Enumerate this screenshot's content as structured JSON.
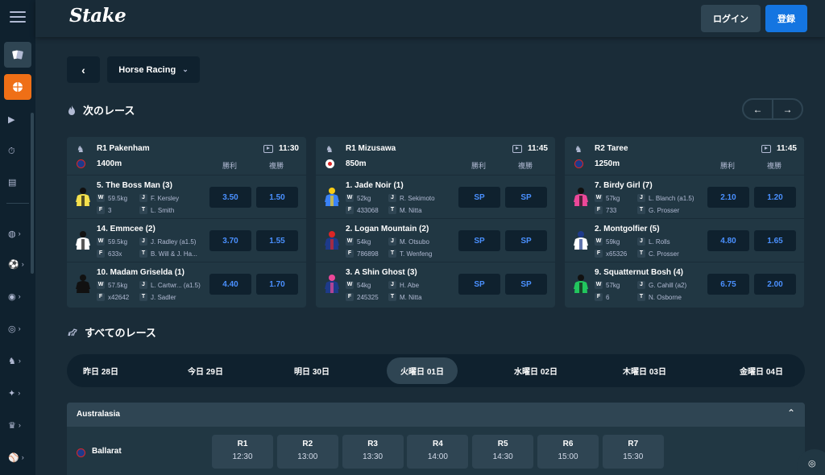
{
  "header": {
    "logo": "Stake",
    "login_label": "ログイン",
    "register_label": "登録"
  },
  "sidebar": {
    "items": [
      {
        "icon": "casino-icon"
      },
      {
        "icon": "sports-icon",
        "active": true
      },
      {
        "icon": "live-icon"
      },
      {
        "icon": "stopwatch-icon"
      },
      {
        "icon": "betslip-icon"
      },
      {
        "icon": "tennis-icon"
      },
      {
        "icon": "soccer-icon"
      },
      {
        "icon": "basketball-icon"
      },
      {
        "icon": "volleyball-icon"
      },
      {
        "icon": "horse-icon"
      },
      {
        "icon": "cricket-icon"
      },
      {
        "icon": "trophy-icon"
      },
      {
        "icon": "baseball-icon"
      }
    ]
  },
  "filter": {
    "sport": "Horse Racing"
  },
  "next_races": {
    "title": "次のレース",
    "win_label": "勝利",
    "place_label": "複勝",
    "cards": [
      {
        "race": "R1 Pakenham",
        "time": "11:30",
        "distance": "1400m",
        "flag_color": "#1e3a8a",
        "runners": [
          {
            "name": "5. The Boss Man  (3)",
            "weight": "59.5kg",
            "jockey": "F. Kersley",
            "form": "3",
            "trainer": "L. Smith",
            "win": "3.50",
            "place": "1.50",
            "silk": [
              "#f4e04d",
              "#111111"
            ]
          },
          {
            "name": "14. Emmcee  (2)",
            "weight": "59.5kg",
            "jockey": "J. Radley (a1.5)",
            "form": "633x",
            "trainer": "B. Will & J. Ha...",
            "win": "3.70",
            "place": "1.55",
            "silk": [
              "#ffffff",
              "#111111"
            ]
          },
          {
            "name": "10. Madam Griselda  (1)",
            "weight": "57.5kg",
            "jockey": "L. Cartwr...  (a1.5)",
            "form": "x42642",
            "trainer": "J. Sadler",
            "win": "4.40",
            "place": "1.70",
            "silk": [
              "#111111",
              "#111111"
            ]
          }
        ]
      },
      {
        "race": "R1 Mizusawa",
        "time": "11:45",
        "distance": "850m",
        "flag_color": "#ffffff",
        "runners": [
          {
            "name": "1. Jade Noir  (1)",
            "weight": "52kg",
            "jockey": "R. Sekimoto",
            "form": "433068",
            "trainer": "M. Nitta",
            "win": "SP",
            "place": "SP",
            "silk": [
              "#3b82f6",
              "#facc15"
            ]
          },
          {
            "name": "2. Logan Mountain  (2)",
            "weight": "54kg",
            "jockey": "M. Otsubo",
            "form": "786898",
            "trainer": "T. Wenfeng",
            "win": "SP",
            "place": "SP",
            "silk": [
              "#1e3a8a",
              "#dc2626"
            ]
          },
          {
            "name": "3. A Shin Ghost  (3)",
            "weight": "54kg",
            "jockey": "H. Abe",
            "form": "245325",
            "trainer": "M. Nitta",
            "win": "SP",
            "place": "SP",
            "silk": [
              "#1e3a8a",
              "#ec4899"
            ]
          }
        ]
      },
      {
        "race": "R2 Taree",
        "time": "11:45",
        "distance": "1250m",
        "flag_color": "#1e3a8a",
        "runners": [
          {
            "name": "7. Birdy Girl  (7)",
            "weight": "57kg",
            "jockey": "L. Blanch (a1.5)",
            "form": "733",
            "trainer": "G. Prosser",
            "win": "2.10",
            "place": "1.20",
            "silk": [
              "#ec4899",
              "#111111"
            ]
          },
          {
            "name": "2. Montgolfier  (5)",
            "weight": "59kg",
            "jockey": "L. Rolls",
            "form": "x65326",
            "trainer": "C. Prosser",
            "win": "4.80",
            "place": "1.65",
            "silk": [
              "#ffffff",
              "#1e3a8a"
            ]
          },
          {
            "name": "9. Squatternut Bosh  (4)",
            "weight": "57kg",
            "jockey": "G. Cahill (a2)",
            "form": "6",
            "trainer": "N. Osborne",
            "win": "6.75",
            "place": "2.00",
            "silk": [
              "#22c55e",
              "#111111"
            ]
          }
        ]
      }
    ]
  },
  "all_races": {
    "title": "すべてのレース",
    "dates": [
      {
        "label": "昨日 28日"
      },
      {
        "label": "今日 29日"
      },
      {
        "label": "明日 30日"
      },
      {
        "label": "火曜日 01日",
        "active": true
      },
      {
        "label": "水曜日 02日"
      },
      {
        "label": "木曜日 03日"
      },
      {
        "label": "金曜日 04日"
      }
    ],
    "region": "Australasia",
    "track": "Ballarat",
    "races": [
      {
        "num": "R1",
        "time": "12:30"
      },
      {
        "num": "R2",
        "time": "13:00"
      },
      {
        "num": "R3",
        "time": "13:30"
      },
      {
        "num": "R4",
        "time": "14:00"
      },
      {
        "num": "R5",
        "time": "14:30"
      },
      {
        "num": "R6",
        "time": "15:00"
      },
      {
        "num": "R7",
        "time": "15:30"
      }
    ]
  }
}
